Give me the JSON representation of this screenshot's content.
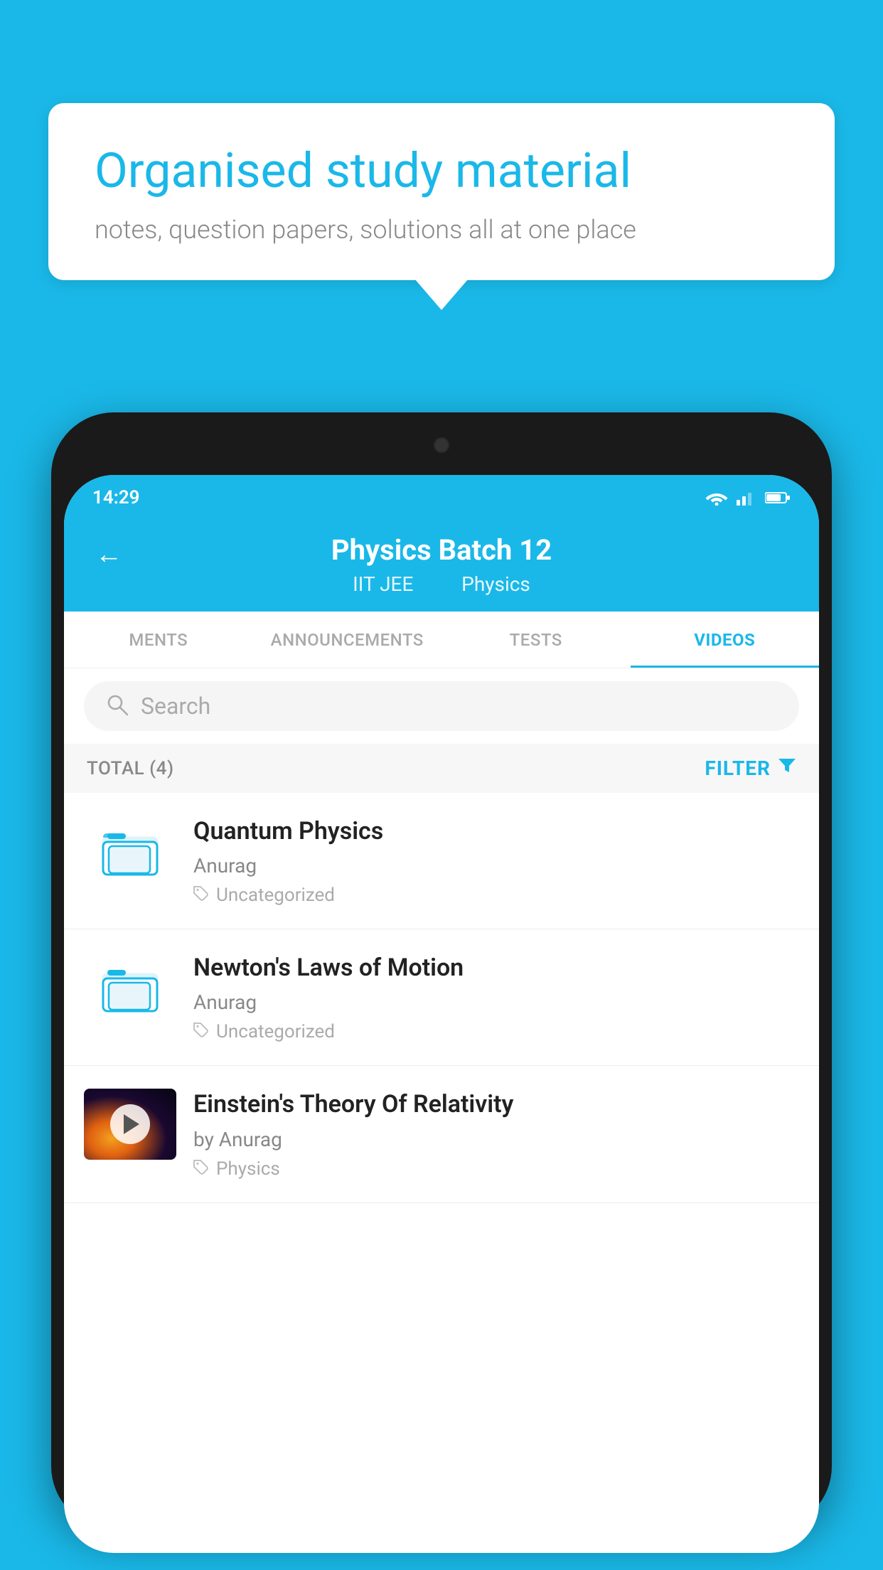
{
  "page": {
    "background_color": "#1ab8e8"
  },
  "speech_bubble": {
    "title": "Organised study material",
    "subtitle": "notes, question papers, solutions all at one place"
  },
  "status_bar": {
    "time": "14:29",
    "wifi": "wifi",
    "signal": "signal",
    "battery": "battery"
  },
  "app_bar": {
    "back_label": "←",
    "title": "Physics Batch 12",
    "subtitle_part1": "IIT JEE",
    "subtitle_part2": "Physics"
  },
  "tabs": [
    {
      "label": "MENTS",
      "active": false
    },
    {
      "label": "ANNOUNCEMENTS",
      "active": false
    },
    {
      "label": "TESTS",
      "active": false
    },
    {
      "label": "VIDEOS",
      "active": true
    }
  ],
  "search": {
    "placeholder": "Search"
  },
  "filter_row": {
    "total_label": "TOTAL (4)",
    "filter_label": "FILTER"
  },
  "video_items": [
    {
      "title": "Quantum Physics",
      "author": "Anurag",
      "tag": "Uncategorized",
      "has_thumbnail": false,
      "type": "folder"
    },
    {
      "title": "Newton's Laws of Motion",
      "author": "Anurag",
      "tag": "Uncategorized",
      "has_thumbnail": false,
      "type": "folder"
    },
    {
      "title": "Einstein's Theory Of Relativity",
      "author": "by Anurag",
      "tag": "Physics",
      "has_thumbnail": true,
      "type": "video"
    }
  ]
}
